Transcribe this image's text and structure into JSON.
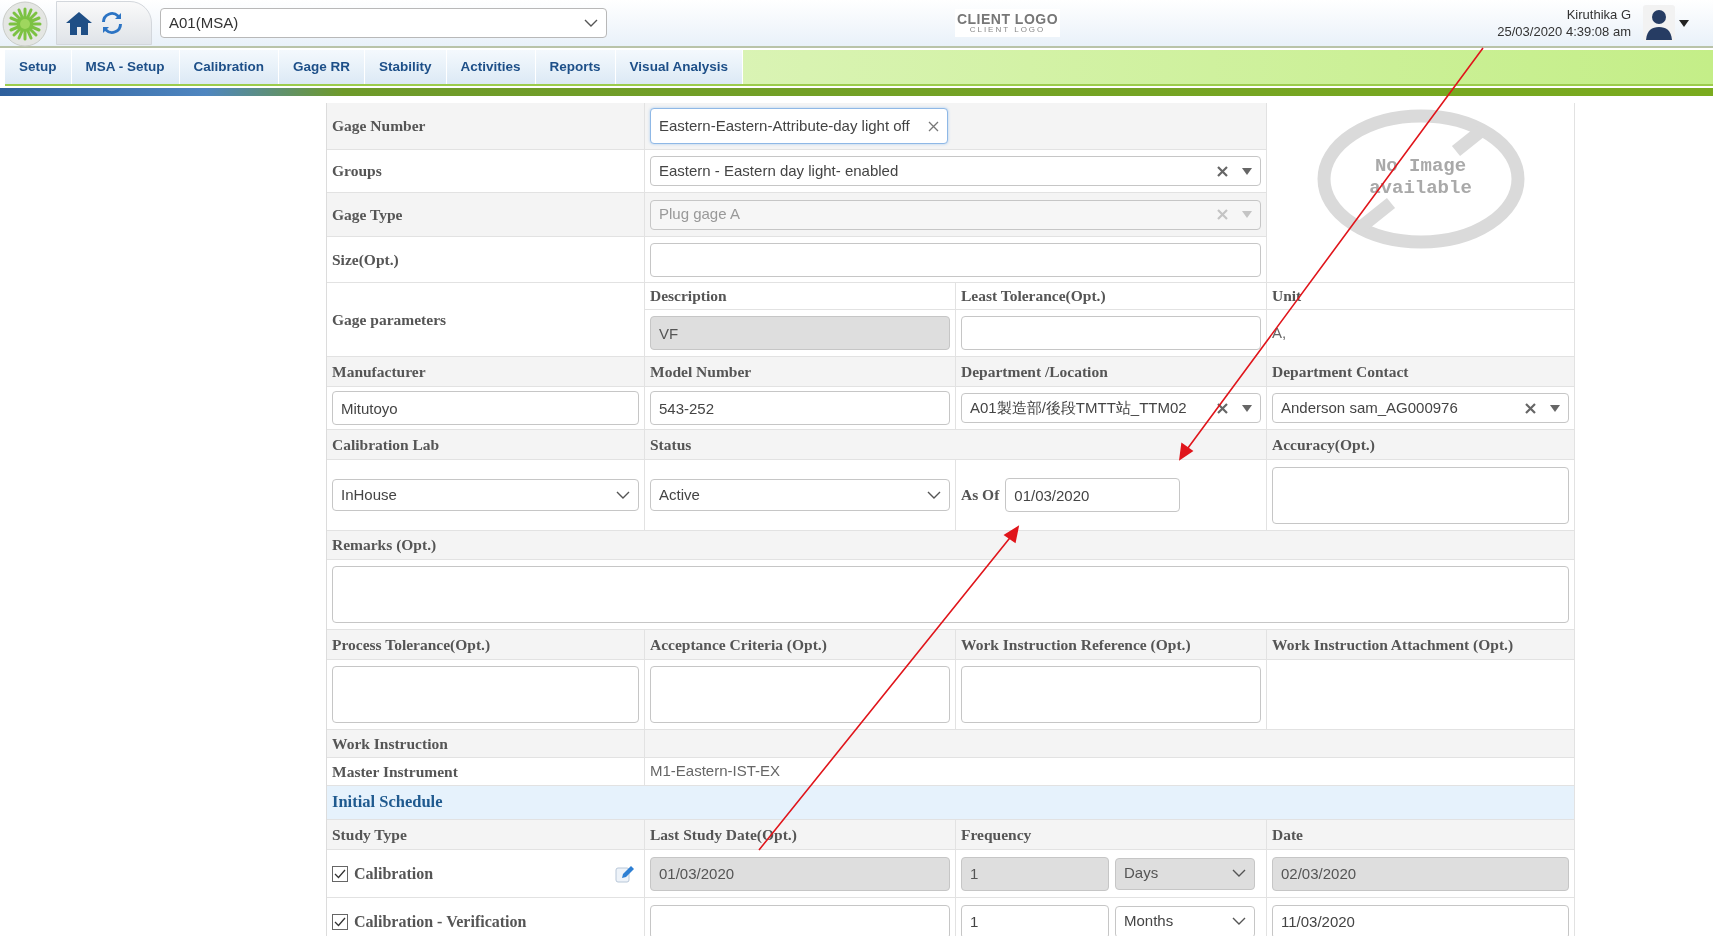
{
  "header": {
    "project": "A01(MSA)",
    "client_logo": "CLIENT LOGO",
    "client_logo_sub": "CLIENT LOGO",
    "user_name": "Kiruthika G",
    "datetime": "25/03/2020 4:39:08 am"
  },
  "menu": [
    {
      "label": "Setup",
      "selected": false
    },
    {
      "label": "MSA - Setup",
      "selected": false
    },
    {
      "label": "Calibration",
      "selected": false
    },
    {
      "label": "Gage RR",
      "selected": false
    },
    {
      "label": "Stability",
      "selected": false
    },
    {
      "label": "Activities",
      "selected": false
    },
    {
      "label": "Reports",
      "selected": false
    },
    {
      "label": "Visual Analysis",
      "selected": false
    }
  ],
  "gage": {
    "gage_number": {
      "label": "Gage Number",
      "kind": "clearable",
      "value": "Eastern-Eastern-Attribute-day light off"
    },
    "groups": {
      "label": "Groups",
      "kind": "combo",
      "value": "Eastern - Eastern day light- enabled",
      "disabled": false
    },
    "gage_type": {
      "label": "Gage Type",
      "kind": "combo",
      "value": "Plug gage A",
      "disabled": true
    },
    "size": {
      "label": "Size(Opt.)",
      "kind": "text"
    },
    "image_placeholder": "No Image available",
    "gage_parameters": {
      "label": "Gage parameters",
      "fields": [
        {
          "label": "Description",
          "kind": "text",
          "value": "VF",
          "disabled": true
        },
        {
          "label": "Least Tolerance(Opt.)",
          "kind": "text",
          "disabled": false
        },
        {
          "label": "Unit",
          "kind": "static",
          "value": "A,"
        }
      ]
    },
    "row_a": [
      {
        "label": "Manufacturer",
        "kind": "text",
        "value": "Mitutoyo"
      },
      {
        "label": "Model Number",
        "kind": "text",
        "value": "543-252"
      },
      {
        "label": "Department /Location",
        "kind": "combo",
        "value": "A01製造部/後段TMTT站_TTM02"
      },
      {
        "label": "Department Contact",
        "kind": "combo",
        "value": "Anderson sam_AG000976"
      }
    ],
    "calibration_lab": {
      "label": "Calibration Lab",
      "kind": "select",
      "value": "InHouse"
    },
    "status": {
      "label": "Status",
      "kind": "select",
      "value": "Active",
      "as_of_label": "As Of",
      "as_of": "01/03/2020"
    },
    "accuracy": {
      "label": "Accuracy(Opt.)",
      "kind": "textarea"
    },
    "remarks": {
      "label": "Remarks (Opt.)",
      "kind": "textarea"
    },
    "row_b": [
      {
        "label": "Process Tolerance(Opt.)",
        "kind": "textarea"
      },
      {
        "label": "Acceptance Criteria (Opt.)",
        "kind": "textarea"
      },
      {
        "label": "Work Instruction Reference (Opt.)",
        "kind": "textarea"
      },
      {
        "label": "Work Instruction Attachment (Opt.)",
        "kind": "none"
      }
    ],
    "work_instruction": {
      "label": "Work Instruction"
    },
    "master_instrument": {
      "label": "Master Instrument",
      "value": "M1-Eastern-IST-EX"
    }
  },
  "schedule": {
    "title": "Initial Schedule",
    "columns": [
      "Study Type",
      "Last Study Date(Opt.)",
      "Frequency",
      "Date"
    ],
    "rows": [
      {
        "study_type": "Calibration",
        "checked": true,
        "editable": true,
        "last_study_date": "01/03/2020",
        "frequency": "1",
        "unit": "Days",
        "date": "02/03/2020",
        "disabled": true
      },
      {
        "study_type": "Calibration - Verification",
        "checked": true,
        "editable": false,
        "frequency": "1",
        "unit": "Months",
        "date": "11/03/2020",
        "disabled": false
      }
    ]
  }
}
